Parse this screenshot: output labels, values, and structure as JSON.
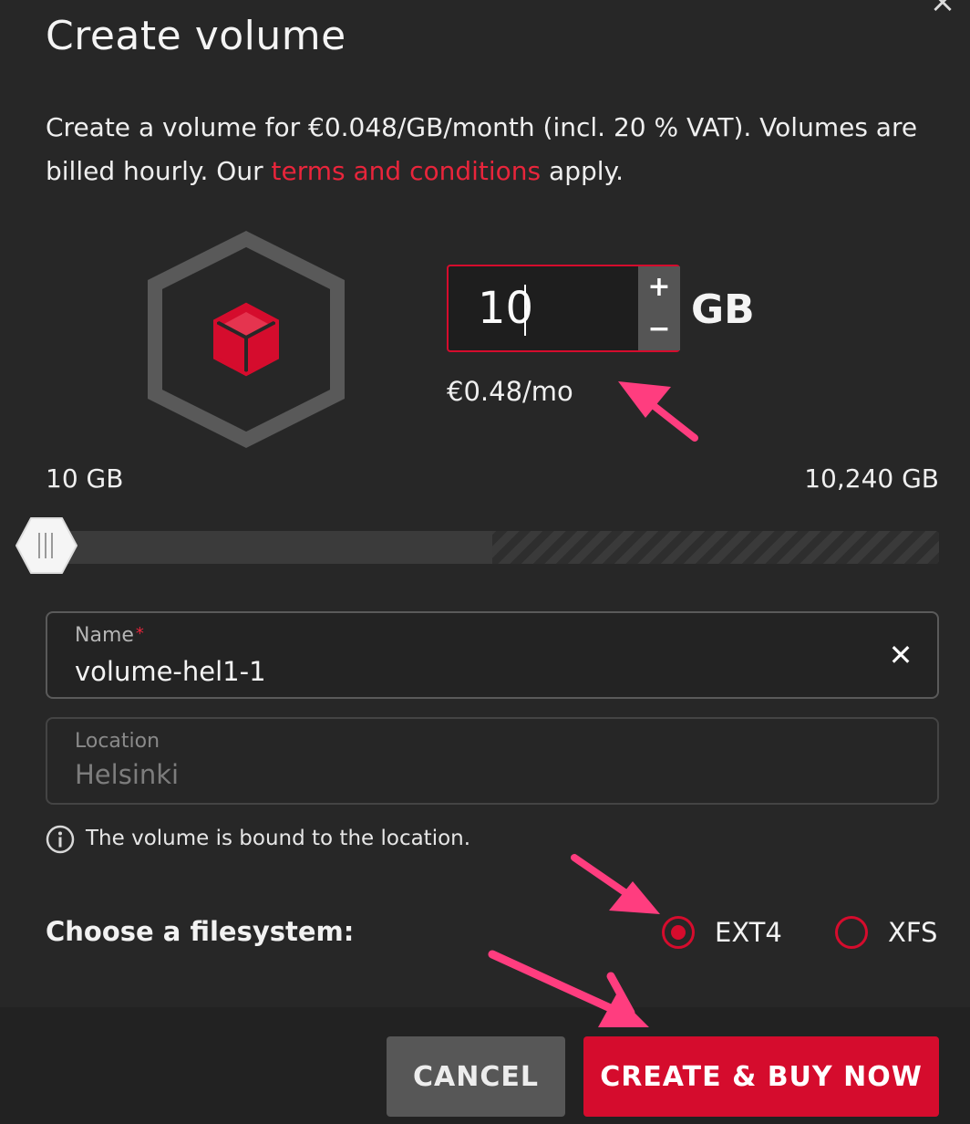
{
  "dialog": {
    "title": "Create volume",
    "close_icon": "×",
    "description_prefix": "Create a volume for €0.048/GB/month (incl. 20 % VAT). Volumes are billed hourly. Our ",
    "terms_link": "terms and conditions",
    "description_suffix": " apply."
  },
  "size": {
    "value": "10",
    "unit": "GB",
    "plus": "+",
    "minus": "−",
    "price": "€0.48/mo",
    "min_label": "10 GB",
    "max_label": "10,240 GB",
    "slider_value_gb": 10
  },
  "name_field": {
    "label": "Name",
    "required_mark": "*",
    "value": "volume-hel1-1",
    "clear_icon": "✕"
  },
  "location_field": {
    "label": "Location",
    "value": "Helsinki"
  },
  "info": {
    "text": "The volume is bound to the location."
  },
  "filesystem": {
    "label": "Choose a filesystem:",
    "options": [
      {
        "label": "EXT4",
        "selected": true
      },
      {
        "label": "XFS",
        "selected": false
      }
    ]
  },
  "buttons": {
    "cancel": "CANCEL",
    "create": "CREATE & BUY NOW"
  },
  "colors": {
    "accent": "#d50c2d",
    "annotation_arrow": "#ff3d7f",
    "background": "#272727"
  }
}
